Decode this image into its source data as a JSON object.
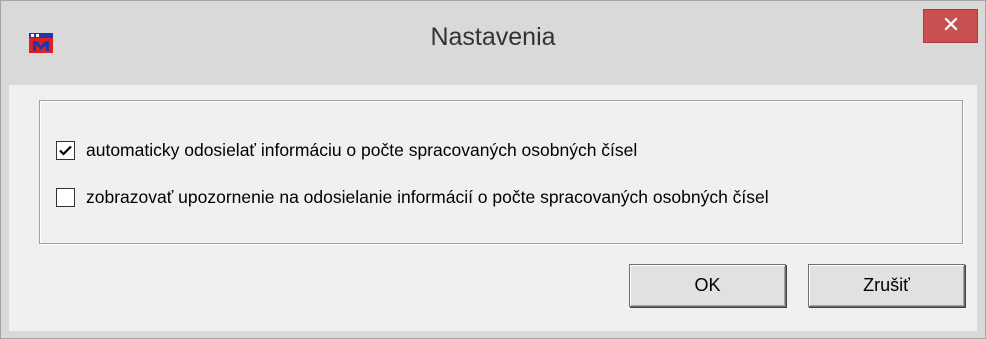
{
  "window": {
    "title": "Nastavenia",
    "app_icon": "app-logo-icon",
    "close_icon": "close-icon"
  },
  "options": [
    {
      "label": "automaticky odosielať informáciu o počte spracovaných osobných čísel",
      "checked": true
    },
    {
      "label": "zobrazovať upozornenie na odosielanie informácií o počte spracovaných osobných čísel",
      "checked": false
    }
  ],
  "buttons": {
    "ok": "OK",
    "cancel": "Zrušiť"
  },
  "colors": {
    "close_button": "#c75050",
    "titlebar": "#d9d9d9",
    "client": "#f0f0f0"
  }
}
